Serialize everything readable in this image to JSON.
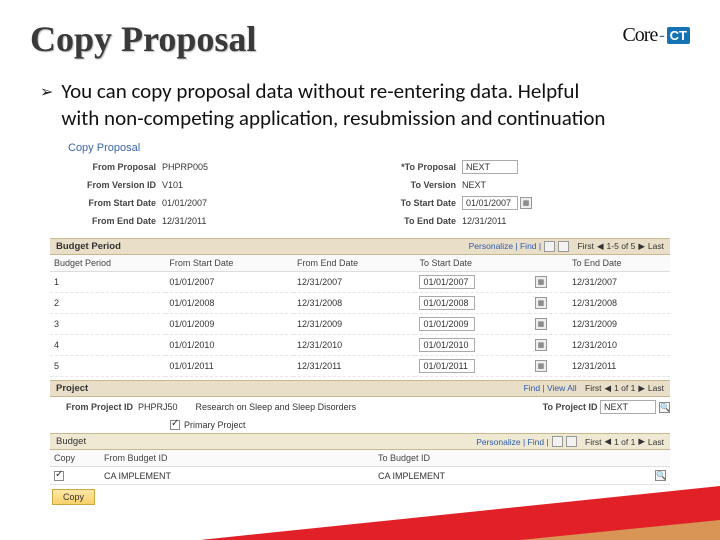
{
  "header": {
    "title": "Copy Proposal",
    "logo_core": "Core",
    "logo_ct": "CT"
  },
  "bullet": "You can copy proposal data without re-entering data. Helpful with non-competing application, resubmission and continuation",
  "form": {
    "section": "Copy Proposal",
    "from_proposal_label": "From Proposal",
    "from_proposal": "PHPRP005",
    "to_proposal_label": "*To Proposal",
    "to_proposal": "NEXT",
    "from_version_label": "From Version ID",
    "from_version": "V101",
    "to_version_label": "To Version",
    "to_version": "NEXT",
    "from_start_label": "From Start Date",
    "from_start": "01/01/2007",
    "to_start_label": "To Start Date",
    "to_start": "01/01/2007",
    "from_end_label": "From End Date",
    "from_end": "12/31/2011",
    "to_end_label": "To End Date",
    "to_end": "12/31/2011"
  },
  "budget_bar": {
    "title": "Budget Period",
    "links": "Personalize | Find |",
    "nav": "First",
    "range": "1-5 of 5",
    "last": "Last"
  },
  "budget_table": {
    "cols": [
      "Budget Period",
      "From Start Date",
      "From End Date",
      "To Start Date",
      "To End Date"
    ],
    "rows": [
      [
        "1",
        "01/01/2007",
        "12/31/2007",
        "01/01/2007",
        "12/31/2007"
      ],
      [
        "2",
        "01/01/2008",
        "12/31/2008",
        "01/01/2008",
        "12/31/2008"
      ],
      [
        "3",
        "01/01/2009",
        "12/31/2009",
        "01/01/2009",
        "12/31/2009"
      ],
      [
        "4",
        "01/01/2010",
        "12/31/2010",
        "01/01/2010",
        "12/31/2010"
      ],
      [
        "5",
        "01/01/2011",
        "12/31/2011",
        "01/01/2011",
        "12/31/2011"
      ]
    ]
  },
  "project_bar": {
    "title": "Project",
    "links": "Find | View All",
    "nav": "First",
    "range": "1 of 1",
    "last": "Last"
  },
  "project": {
    "from_label": "From Project ID",
    "from": "PHPRJ50",
    "desc": "Research on Sleep and Sleep Disorders",
    "to_label": "To Project ID",
    "to": "NEXT",
    "primary_label": "Primary Project"
  },
  "budget2_bar": {
    "title": "Budget",
    "links": "Personalize | Find |",
    "nav": "First",
    "range": "1 of 1",
    "last": "Last"
  },
  "budget2": {
    "cols": [
      "Copy",
      "From Budget ID",
      "To Budget ID"
    ],
    "from": "CA IMPLEMENT",
    "to": "CA IMPLEMENT"
  },
  "copy_btn": "Copy"
}
